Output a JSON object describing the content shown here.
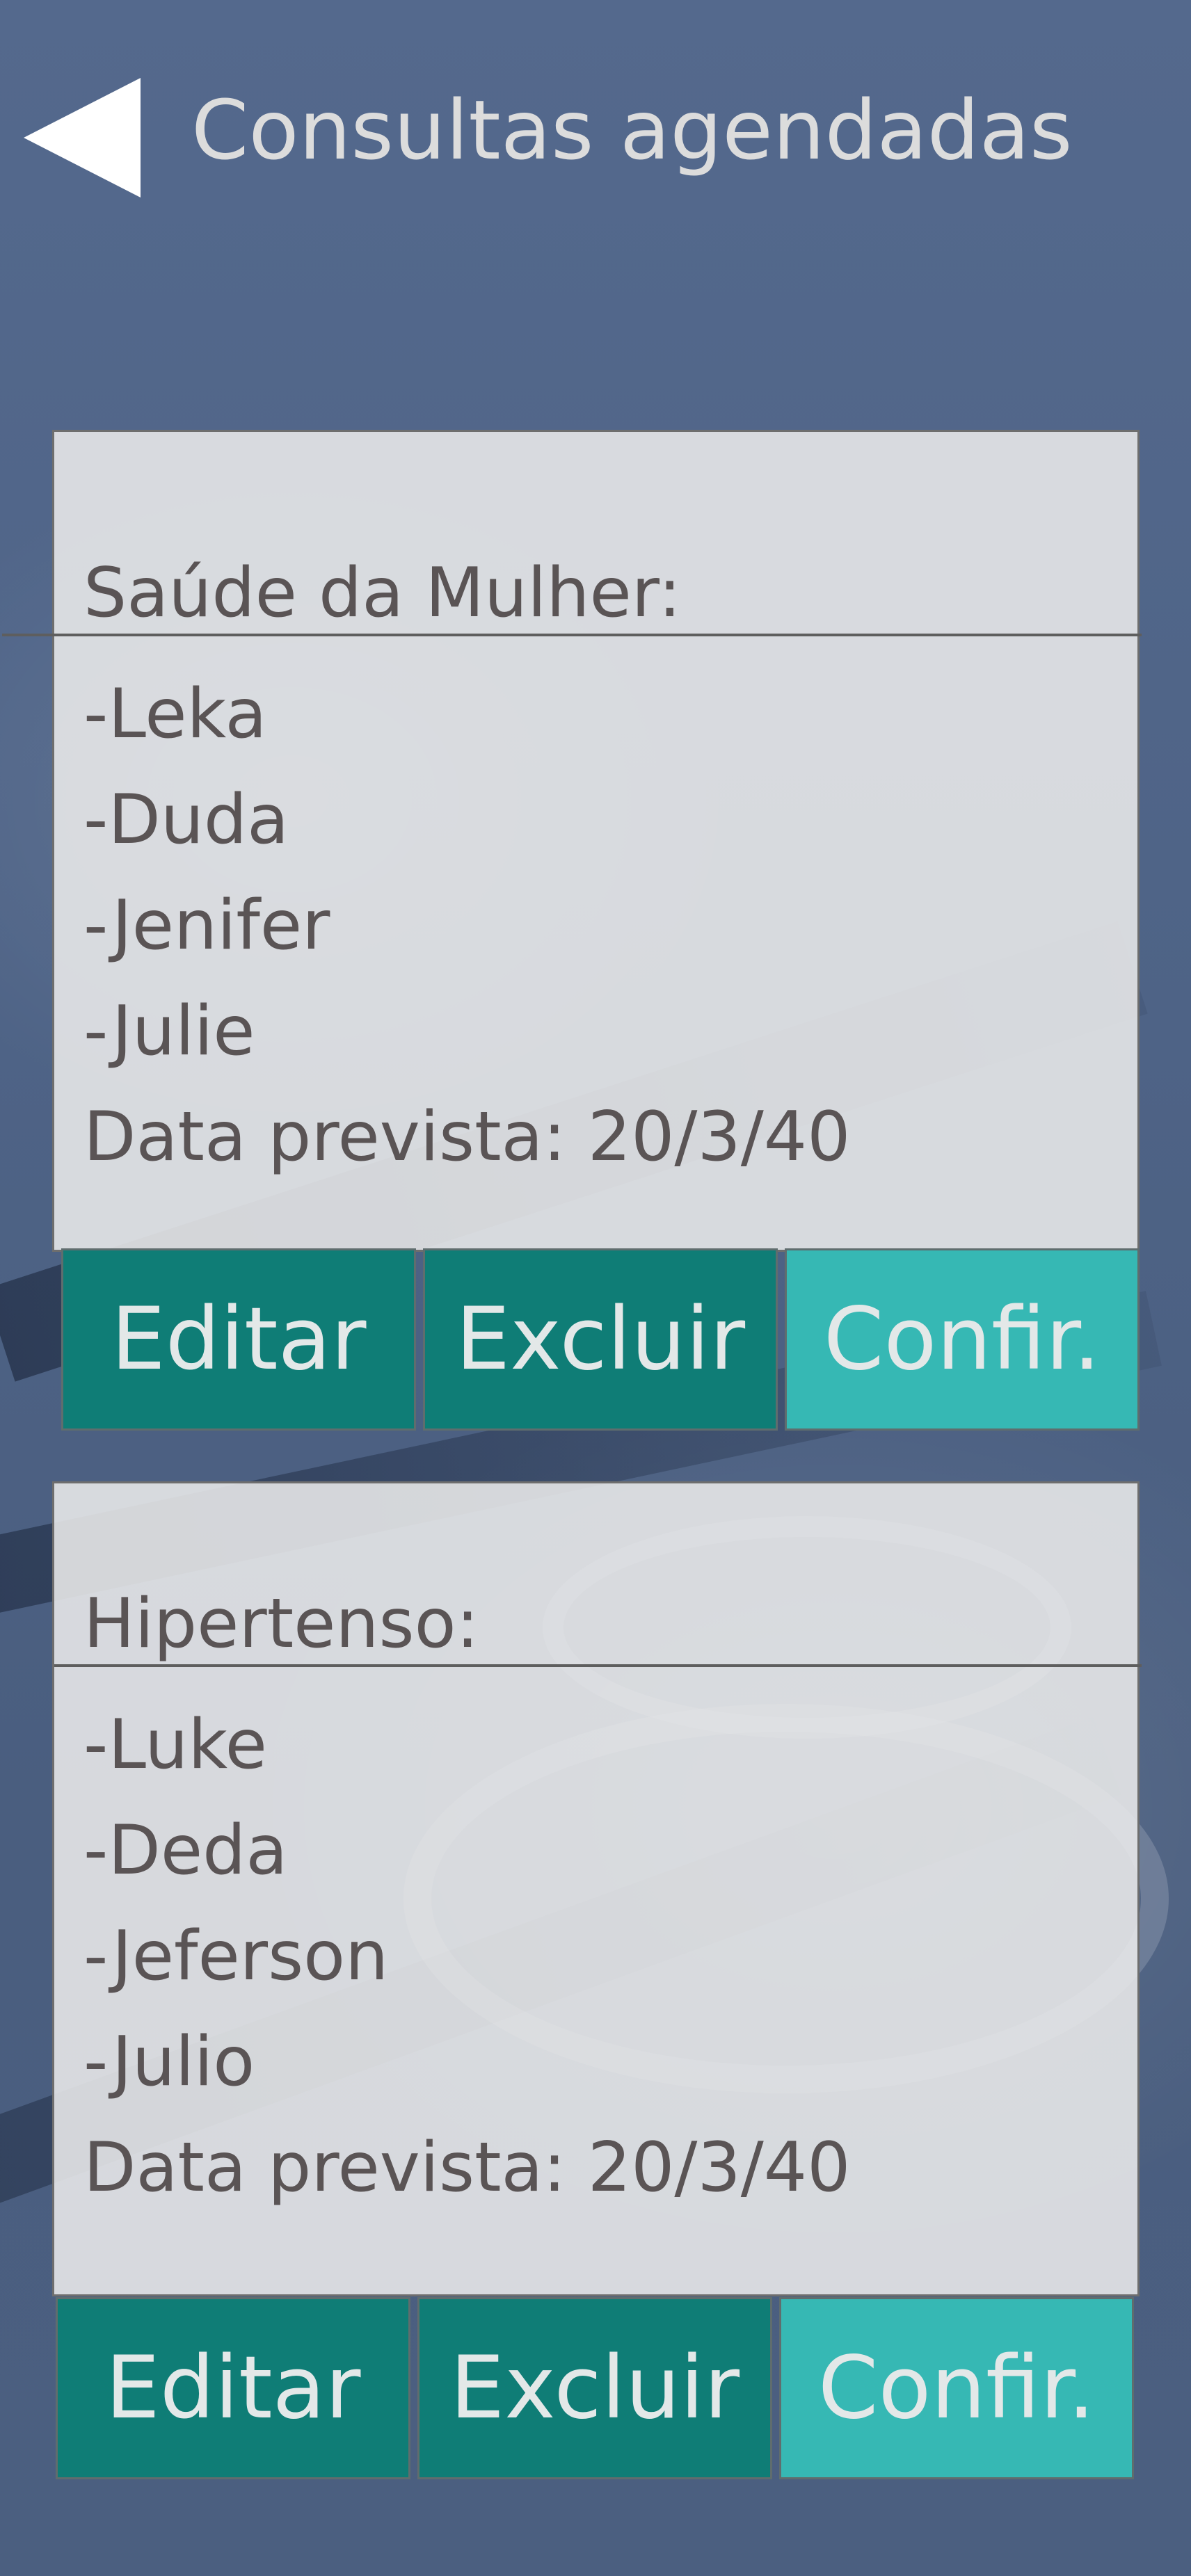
{
  "header": {
    "back_icon": "back-arrow-icon",
    "title": "Consultas agendadas"
  },
  "colors": {
    "background": "#4f6386",
    "card": "#ebebeb",
    "text": "#5a5455",
    "button_dark": "#0f7d76",
    "button_light": "#36b8b4",
    "button_text": "#e3e8e8"
  },
  "appointments": [
    {
      "group": "Saúde da Mulher:",
      "patients": [
        "-Leka",
        "-Duda",
        "-Jenifer",
        "-Julie"
      ],
      "date_label": "Data prevista: ",
      "date": "20/3/40",
      "actions": {
        "edit": "Editar",
        "delete": "Excluir",
        "confirm": "Confir."
      }
    },
    {
      "group": "Hipertenso:",
      "patients": [
        "-Luke",
        "-Deda",
        "-Jeferson",
        "-Julio"
      ],
      "date_label": "Data prevista: ",
      "date": "20/3/40",
      "actions": {
        "edit": "Editar",
        "delete": "Excluir",
        "confirm": "Confir."
      }
    }
  ]
}
